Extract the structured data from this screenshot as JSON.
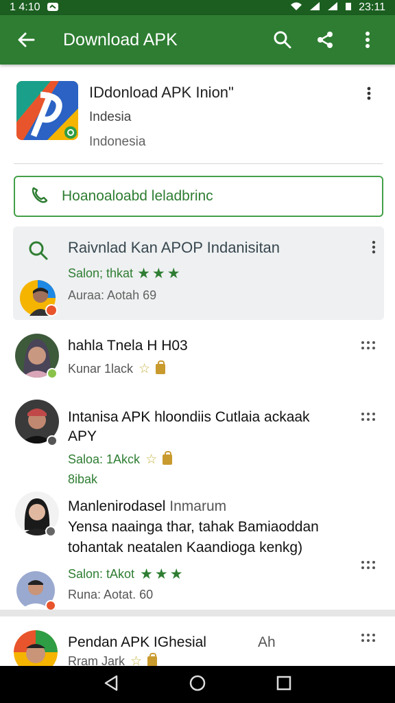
{
  "status_bar": {
    "left_time": "1 4:10",
    "right_time": "23:11"
  },
  "app_bar": {
    "title": "Download APK"
  },
  "app_header": {
    "name": "IDdonload APK Inion\"",
    "subtitle_1": "Indesia",
    "subtitle_2": "Indonesia"
  },
  "search": {
    "value": "Hoanoaloabd leladbrinc"
  },
  "featured": {
    "title": "Raivnlad Kan APOP Indanisitan",
    "rating_label": "Salon; thkat",
    "stars": "★★★",
    "author": "Auraa: Aotah 69"
  },
  "list": [
    {
      "title": "hahla Tnela H H03",
      "meta": "Kunar 1lack",
      "stars": "☆"
    },
    {
      "title": "Intanisa APK hloondiis Cutlaia ackaak",
      "title_line2": "APY",
      "rating_label": "Saloa: 1Akck",
      "stars": "☆",
      "extra": "8ibak"
    },
    {
      "title": "Manlenirodasel",
      "title_suffix": "Inmarum",
      "desc_line1": "Yensa naainga thar, tahak Bamiaoddan",
      "desc_line2": "tohantak neatalen Kaandioga kenkg)",
      "rating_label": "Salon: tAkot",
      "stars": "★★★",
      "author": "Runa: Aotat. 60"
    },
    {
      "title": "Pendan APK IGhesial",
      "side_text": "Ah",
      "meta": "Rram Jark",
      "stars": "☆"
    }
  ],
  "colors": {
    "primary": "#2e7d32",
    "status": "#1b5e20",
    "accent_star": "#2e7d32"
  },
  "icons": [
    "back-arrow-icon",
    "search-icon",
    "share-icon",
    "more-vert-icon",
    "phone-icon",
    "grid-dots-icon",
    "bag-icon",
    "nav-back-icon",
    "nav-home-icon",
    "nav-recents-icon"
  ]
}
